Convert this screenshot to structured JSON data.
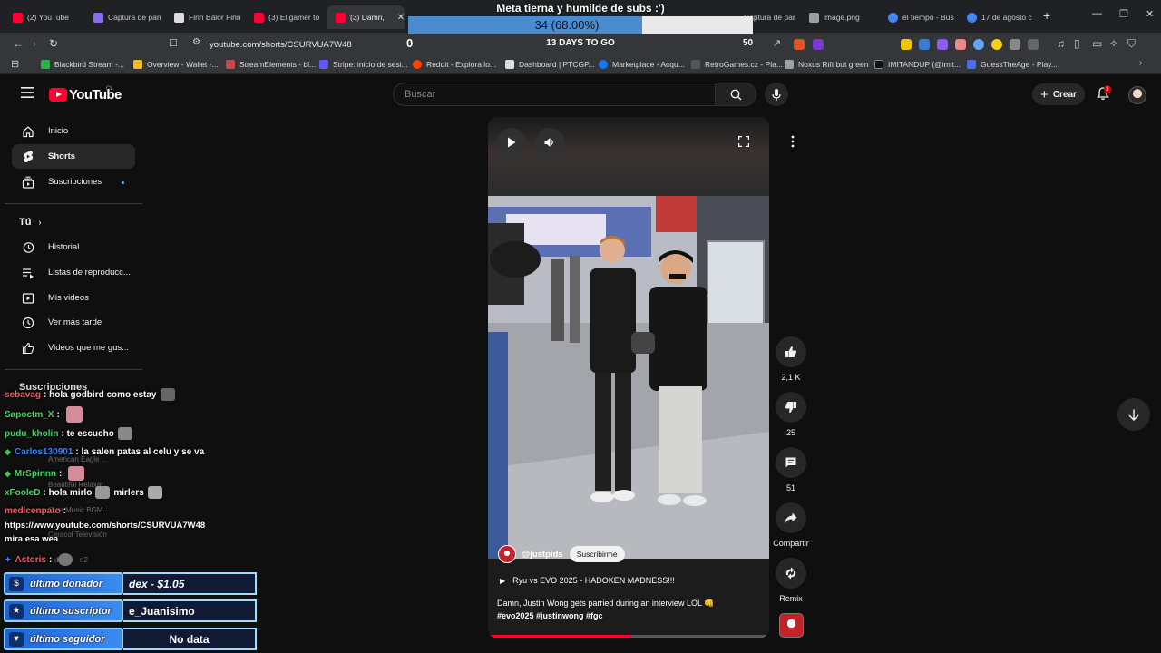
{
  "browser": {
    "tabs": [
      {
        "label": "(2) YouTube",
        "color": "#ff0033"
      },
      {
        "label": "Captura de pan",
        "color": "#8a6cf0"
      },
      {
        "label": "Finn Bálor Finn",
        "color": "#dddddd"
      },
      {
        "label": "(3) El gamer tó",
        "color": "#ff0033"
      },
      {
        "label": "(3) Damn,",
        "color": "#ff0033"
      },
      {
        "label": "Captura de par",
        "color": "#8a6cf0"
      },
      {
        "label": "image.png",
        "color": "#9aa0a6"
      },
      {
        "label": "el tiempo - Bus",
        "color": "#4285f4"
      },
      {
        "label": "17 de agosto c",
        "color": "#4285f4"
      }
    ],
    "url": "youtube.com/shorts/CSURVUA7W48",
    "bookmarks": [
      {
        "label": "Blackbird Stream -...",
        "color": "#2db24a"
      },
      {
        "label": "Overview - Wallet -...",
        "color": "#f3ba2f"
      },
      {
        "label": "StreamElements - bl...",
        "color": "#c24b4b"
      },
      {
        "label": "Stripe: inicio de sesi...",
        "color": "#635bff"
      },
      {
        "label": "Reddit - Explora lo...",
        "color": "#ff4500"
      },
      {
        "label": "Dashboard | PTCGP...",
        "color": "#dddddd"
      },
      {
        "label": "Marketplace - Acqu...",
        "color": "#1877f2"
      },
      {
        "label": "RetroGames.cz - Pla...",
        "color": "#333333"
      },
      {
        "label": "Noxus Rift but green",
        "color": "#9aa0a6"
      },
      {
        "label": "IMITANDUP (@imit...",
        "color": "#111111"
      },
      {
        "label": "GuessTheAge - Play...",
        "color": "#4a6cf0"
      }
    ]
  },
  "goal": {
    "title": "Meta tierna y humilde de subs :')",
    "progress_text": "34 (68.00%)",
    "progress_fraction": 0.68,
    "current": "0",
    "days_left": "13 DAYS TO GO",
    "target": "50"
  },
  "youtube": {
    "logo_text": "YouTube",
    "country_code": "CL",
    "search_placeholder": "Buscar",
    "create_label": "Crear",
    "notification_count": "3"
  },
  "sidebar": {
    "main": [
      {
        "label": "Inicio",
        "icon": "home-icon"
      },
      {
        "label": "Shorts",
        "icon": "shorts-icon"
      },
      {
        "label": "Suscripciones",
        "icon": "subscriptions-icon"
      }
    ],
    "you_title": "Tú",
    "you_items": [
      {
        "label": "Historial",
        "icon": "history-icon"
      },
      {
        "label": "Listas de reproducc...",
        "icon": "playlists-icon"
      },
      {
        "label": "Mis videos",
        "icon": "my-videos-icon"
      },
      {
        "label": "Ver más tarde",
        "icon": "watch-later-icon"
      },
      {
        "label": "Videos que me gus...",
        "icon": "liked-icon"
      }
    ],
    "subscriptions_title": "Suscripciones"
  },
  "chat": [
    {
      "user": "sebavag",
      "message": "hola godbird como estay",
      "user_color": "#ff5566"
    },
    {
      "user": "Sapoctm_X",
      "message": "",
      "user_color": "#44d466"
    },
    {
      "user": "pudu_kholin",
      "message": "te escucho",
      "user_color": "#44d466"
    },
    {
      "user": "Carlos130901",
      "message": "la salen patas al celu y se va",
      "user_color": "#3c82f6"
    },
    {
      "user": "MrSpinnn",
      "message": "",
      "user_color": "#44d466"
    },
    {
      "user": "xFooleD",
      "message": "hola mirlo",
      "message_after": "mirlers",
      "user_color": "#44d466"
    },
    {
      "user": "medicenpato",
      "message": "",
      "user_color": "#ff5566"
    },
    {
      "user": "",
      "message": "https://www.youtube.com/shorts/CSURVUA7W48",
      "user_color": "#ffffff"
    },
    {
      "user": "",
      "message": "mira esa wea",
      "user_color": "#ffffff"
    },
    {
      "user": "Astoris",
      "message": "",
      "user_color": "#ff5566"
    }
  ],
  "chat_ghosts": [
    "American Eagle ...",
    "Beautiful Relaxat...",
    "Cute Music BGM...",
    "Caracol Televisión",
    "dirt.",
    "n2"
  ],
  "alerts": [
    {
      "label": "último donador",
      "value": "dex - $1.05"
    },
    {
      "label": "último suscriptor",
      "value": "e_Juanisimo"
    },
    {
      "label": "último seguidor",
      "value": "No data"
    }
  ],
  "short": {
    "channel": "@justpids",
    "subscribe_label": "Suscribirme",
    "audio": "Ryu vs EVO 2025 - HADOKEN MADNESS!!!",
    "description": "Damn, Justin Wong gets parried during an interview LOL 👊",
    "hashtags": "#evo2025 #justinwong #fgc",
    "progress": 0.51
  },
  "actions": {
    "likes": "2,1 K",
    "dislikes": "25",
    "comments": "51",
    "share": "Compartir",
    "remix": "Remix"
  },
  "colors": {
    "youtube_red": "#ff0033",
    "goal_fill": "#4d8bcf",
    "alert_blue": "#2a72e0",
    "link_blue": "#3ea6ff"
  }
}
